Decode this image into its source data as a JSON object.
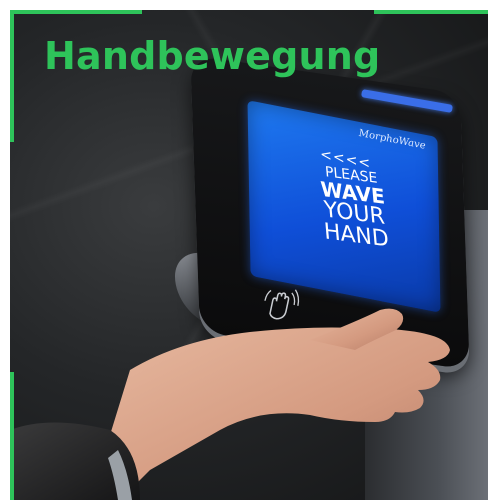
{
  "title": "Handbewegung",
  "device": {
    "brand": "MorphoWave",
    "arrows": "<<<<",
    "line1": "PLEASE",
    "line2": "WAVE",
    "line3": "YOUR",
    "line4": "HAND"
  },
  "colors": {
    "accent": "#2ec35a",
    "screen": "#1565e8"
  },
  "icons": [
    "hand-wave-icon"
  ]
}
